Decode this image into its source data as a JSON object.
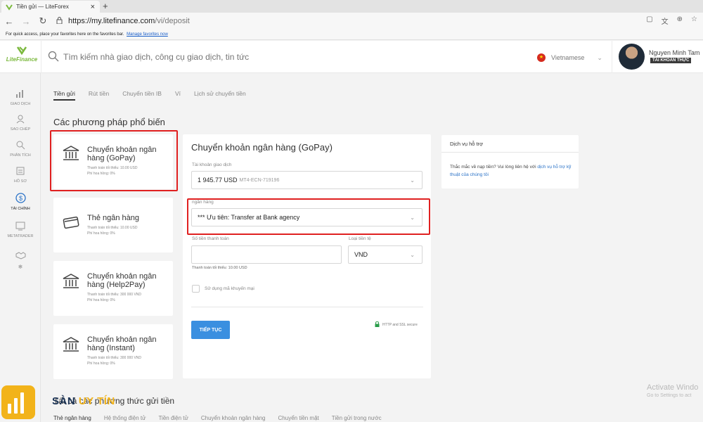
{
  "browser": {
    "tab_title": "Tiền gửi — LiteForex",
    "tab_close": "×",
    "new_tab": "+",
    "url_prefix": "https://my.litefinance.com",
    "url_path": "/vi/deposit",
    "favbar_text": "For quick access, place your favorites here on the favorites bar.",
    "favbar_link": "Manage favorites now"
  },
  "header": {
    "logo_text": "LiteFinance",
    "search_placeholder": "Tìm kiếm nhà giao dịch, công cụ giao dịch, tin tức",
    "language": "Vietnamese",
    "user_name": "Nguyen Minh Tam",
    "account_badge": "TÀI KHOẢN THỰC"
  },
  "sidebar": {
    "items": [
      {
        "label": "Giao dịch",
        "icon": "chart-icon"
      },
      {
        "label": "Sao chép",
        "icon": "copy-trader-icon"
      },
      {
        "label": "Phân tích",
        "icon": "analysis-icon"
      },
      {
        "label": "Hồ sơ",
        "icon": "profile-icon"
      },
      {
        "label": "Tài chính",
        "icon": "dollar-icon"
      },
      {
        "label": "MetaTrader",
        "icon": "monitor-icon"
      },
      {
        "label": "",
        "icon": "handshake-icon"
      }
    ]
  },
  "tabs": [
    "Tiền gửi",
    "Rút tiền",
    "Chuyển tiền IB",
    "Ví",
    "Lịch sử chuyển tiền"
  ],
  "section_title": "Các phương pháp phổ biến",
  "methods": [
    {
      "name": "Chuyển khoản ngân hàng (GoPay)",
      "min": "Thanh toán tối thiểu: 10.00 USD",
      "fee": "Phí hoa hồng: 0%",
      "icon": "bank-icon"
    },
    {
      "name": "Thẻ ngân hàng",
      "min": "Thanh toán tối thiểu: 10.00 USD",
      "fee": "Phí hoa hồng: 0%",
      "icon": "card-icon"
    },
    {
      "name": "Chuyển khoản ngân hàng (Help2Pay)",
      "min": "Thanh toán tối thiểu: 300 000 VND",
      "fee": "Phí hoa hồng: 0%",
      "icon": "bank-icon"
    },
    {
      "name": "Chuyển khoản ngân hàng (Instant)",
      "min": "Thanh toán tối thiểu: 300 000 VND",
      "fee": "Phí hoa hồng: 0%",
      "icon": "bank-icon"
    }
  ],
  "form": {
    "title": "Chuyển khoản ngân hàng (GoPay)",
    "account_label": "Tài khoản giao dịch",
    "account_value": "1 945.77 USD",
    "account_id": "MT4-ECN-719196",
    "bank_label": "ngân hàng",
    "bank_value": "*** Ưu tiên: Transfer at Bank agency",
    "amount_label": "Số tiền thanh toán",
    "currency_label": "Loại tiền tệ",
    "currency_value": "VND",
    "amount_hint": "Thanh toán tối thiểu: 10.00 USD",
    "promo_label": "Sử dụng mã khuyến mại",
    "submit_label": "TIẾP TỤC",
    "secure_text": "HTTP and SSL secure"
  },
  "support": {
    "title": "Dịch vụ hỗ trợ",
    "text": "Thắc mắc về nạp tiền? Vui lòng liên hệ với ",
    "link": "dịch vụ hỗ trợ kỹ thuật của chúng tôi"
  },
  "bottom": {
    "title": "Tất cả các phương thức gửi tiền",
    "tabs": [
      "Thẻ ngân hàng",
      "Hệ thống điện tử",
      "Tiền điện tử",
      "Chuyển khoản ngân hàng",
      "Chuyển tiền mặt",
      "Tiền gửi trong nước"
    ]
  },
  "overlay": {
    "activate_title": "Activate Windo",
    "activate_sub": "Go to Settings to act",
    "watermark_a": "SÀN ",
    "watermark_b": "UY TÍN"
  },
  "colors": {
    "accent": "#3a8fe0",
    "highlight": "#e02020",
    "brand": "#7ab83c"
  }
}
